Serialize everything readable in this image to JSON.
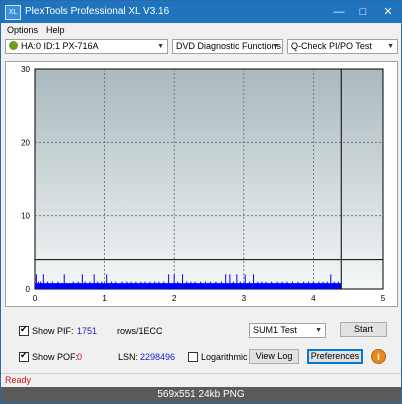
{
  "window": {
    "title": "PlexTools Professional XL V3.16",
    "icon_label": "XL",
    "buttons": {
      "minimize": "—",
      "maximize": "□",
      "close": "✕"
    }
  },
  "menu": [
    {
      "label": "Options"
    },
    {
      "label": "Help"
    }
  ],
  "toolbar": {
    "drive": "HA:0 ID:1  PX-716A",
    "function": "DVD Diagnostic Functions",
    "test": "Q-Check PI/PO Test"
  },
  "chart_data": {
    "type": "bar",
    "x_ticks": [
      "0",
      "1",
      "2",
      "3",
      "4",
      "5"
    ],
    "y_ticks": [
      "0",
      "10",
      "20",
      "30"
    ],
    "xlim": [
      0,
      5
    ],
    "ylim": [
      0,
      30
    ],
    "grid": true,
    "reference_line_y": 4,
    "marker_x": 4.4,
    "bars_color": "#0000ff",
    "pie_bars": [
      {
        "x": 0.02,
        "y": 2
      },
      {
        "x": 0.05,
        "y": 1
      },
      {
        "x": 0.08,
        "y": 1
      },
      {
        "x": 0.12,
        "y": 2
      },
      {
        "x": 0.18,
        "y": 1
      },
      {
        "x": 0.25,
        "y": 1
      },
      {
        "x": 0.33,
        "y": 1
      },
      {
        "x": 0.42,
        "y": 2
      },
      {
        "x": 0.55,
        "y": 1
      },
      {
        "x": 0.62,
        "y": 1
      },
      {
        "x": 0.68,
        "y": 2
      },
      {
        "x": 0.72,
        "y": 1
      },
      {
        "x": 0.79,
        "y": 1
      },
      {
        "x": 0.85,
        "y": 2
      },
      {
        "x": 0.9,
        "y": 1
      },
      {
        "x": 0.96,
        "y": 1
      },
      {
        "x": 1.03,
        "y": 2
      },
      {
        "x": 1.1,
        "y": 1
      },
      {
        "x": 1.16,
        "y": 1
      },
      {
        "x": 1.25,
        "y": 1
      },
      {
        "x": 1.32,
        "y": 1
      },
      {
        "x": 1.38,
        "y": 1
      },
      {
        "x": 1.45,
        "y": 1
      },
      {
        "x": 1.52,
        "y": 1
      },
      {
        "x": 1.58,
        "y": 1
      },
      {
        "x": 1.65,
        "y": 1
      },
      {
        "x": 1.72,
        "y": 1
      },
      {
        "x": 1.78,
        "y": 1
      },
      {
        "x": 1.85,
        "y": 1
      },
      {
        "x": 1.92,
        "y": 2
      },
      {
        "x": 2.0,
        "y": 2
      },
      {
        "x": 2.05,
        "y": 1
      },
      {
        "x": 2.12,
        "y": 2
      },
      {
        "x": 2.18,
        "y": 1
      },
      {
        "x": 2.24,
        "y": 1
      },
      {
        "x": 2.3,
        "y": 1
      },
      {
        "x": 2.38,
        "y": 1
      },
      {
        "x": 2.45,
        "y": 1
      },
      {
        "x": 2.52,
        "y": 1
      },
      {
        "x": 2.6,
        "y": 1
      },
      {
        "x": 2.68,
        "y": 1
      },
      {
        "x": 2.74,
        "y": 2
      },
      {
        "x": 2.8,
        "y": 2
      },
      {
        "x": 2.85,
        "y": 1
      },
      {
        "x": 2.9,
        "y": 2
      },
      {
        "x": 2.95,
        "y": 1
      },
      {
        "x": 3.02,
        "y": 2
      },
      {
        "x": 3.08,
        "y": 1
      },
      {
        "x": 3.14,
        "y": 2
      },
      {
        "x": 3.2,
        "y": 1
      },
      {
        "x": 3.26,
        "y": 1
      },
      {
        "x": 3.32,
        "y": 1
      },
      {
        "x": 3.4,
        "y": 1
      },
      {
        "x": 3.48,
        "y": 1
      },
      {
        "x": 3.55,
        "y": 1
      },
      {
        "x": 3.62,
        "y": 1
      },
      {
        "x": 3.7,
        "y": 1
      },
      {
        "x": 3.78,
        "y": 1
      },
      {
        "x": 3.86,
        "y": 1
      },
      {
        "x": 3.93,
        "y": 1
      },
      {
        "x": 4.0,
        "y": 1
      },
      {
        "x": 4.08,
        "y": 1
      },
      {
        "x": 4.14,
        "y": 1
      },
      {
        "x": 4.2,
        "y": 1
      },
      {
        "x": 4.25,
        "y": 2
      },
      {
        "x": 4.3,
        "y": 1
      },
      {
        "x": 4.36,
        "y": 1
      }
    ],
    "baseline_fill_to_x": 4.4
  },
  "controls": {
    "show_pif_label": "Show PIF:",
    "show_pif_checked": true,
    "pif_value": "1751",
    "rows_label": "rows/1ECC",
    "sum_select": "SUM1 Test",
    "start_label": "Start",
    "show_pof_label": "Show POF:",
    "show_pof_checked": true,
    "pof_value": "0",
    "lsn_label": "LSN:",
    "lsn_value": "2298496",
    "log_label": "Logarithmic",
    "log_checked": false,
    "view_log_label": "View Log",
    "preferences_label": "Preferences",
    "info_label": "i"
  },
  "status": {
    "text": "Ready"
  },
  "caption": {
    "text": "569x551  24kb  PNG"
  }
}
